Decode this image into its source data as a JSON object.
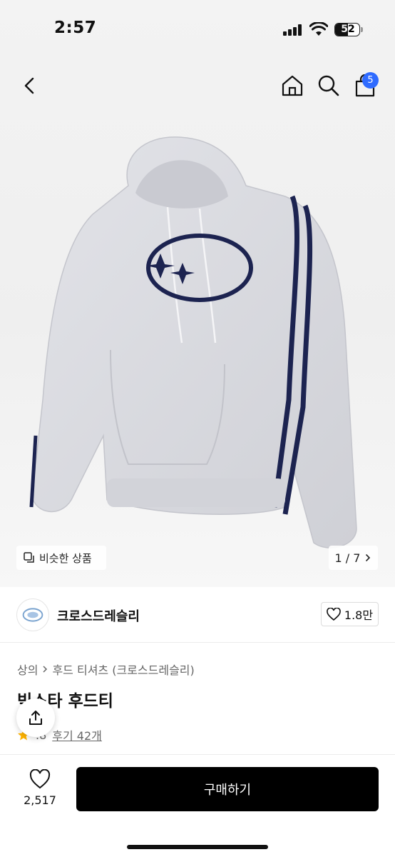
{
  "status_bar": {
    "time": "2:57",
    "battery": "52",
    "battery_level": 0.52
  },
  "nav": {
    "cart_count": "5"
  },
  "hero": {
    "similar_label": "비슷한 상품",
    "page_indicator": "1 / 7"
  },
  "brand": {
    "name": "크로스드레슬리",
    "likes": "1.8만"
  },
  "breadcrumb": {
    "category": "상의",
    "subcategory": "후드 티셔츠 (크로스드레슬리)"
  },
  "product": {
    "title": "빅스타 후드티",
    "rating": ".8",
    "reviews": "후기 42개"
  },
  "bottom_bar": {
    "wish_count": "2,517",
    "buy_label": "구매하기"
  },
  "colors": {
    "accent": "#2f6bff",
    "buy_button": "#000000",
    "star": "#ffb400",
    "hoodie": "#d9dadf",
    "stripe": "#1c2350"
  }
}
